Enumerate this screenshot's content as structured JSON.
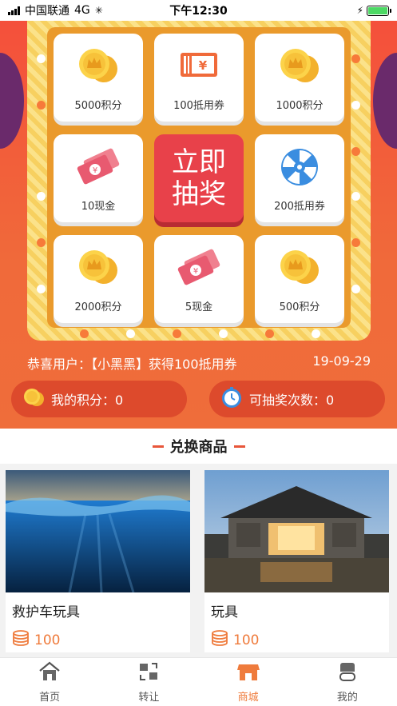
{
  "status_bar": {
    "carrier": "中国联通",
    "network": "4G",
    "time": "下午12:30"
  },
  "prizes": [
    {
      "label": "5000积分",
      "icon": "coins-icon"
    },
    {
      "label": "100抵用券",
      "icon": "ticket-icon"
    },
    {
      "label": "1000积分",
      "icon": "coins-icon"
    },
    {
      "label": "10现金",
      "icon": "cash-icon"
    },
    {
      "label": "200抵用券",
      "icon": "disc-icon"
    },
    {
      "label": "2000积分",
      "icon": "coins-icon"
    },
    {
      "label": "5现金",
      "icon": "cash-icon"
    },
    {
      "label": "500积分",
      "icon": "coins-icon"
    }
  ],
  "draw_button": {
    "line1": "立即",
    "line2": "抽奖"
  },
  "winner": {
    "text": "恭喜用户：【小黑黑】获得100抵用券",
    "date": "19-09-29"
  },
  "my_points": {
    "label": "我的积分：0"
  },
  "draw_count": {
    "label": "可抽奖次数：0"
  },
  "section": {
    "title": "兑换商品"
  },
  "products": [
    {
      "name": "救护车玩具",
      "price": "100"
    },
    {
      "name": "玩具",
      "price": "100"
    }
  ],
  "tabs": [
    {
      "label": "首页",
      "icon": "home-icon"
    },
    {
      "label": "转让",
      "icon": "transfer-icon"
    },
    {
      "label": "商城",
      "icon": "shop-icon",
      "active": true
    },
    {
      "label": "我的",
      "icon": "profile-icon"
    }
  ],
  "colors": {
    "accent": "#ef7b3c",
    "hero": "#f06a3a",
    "draw_button": "#e8414a"
  }
}
